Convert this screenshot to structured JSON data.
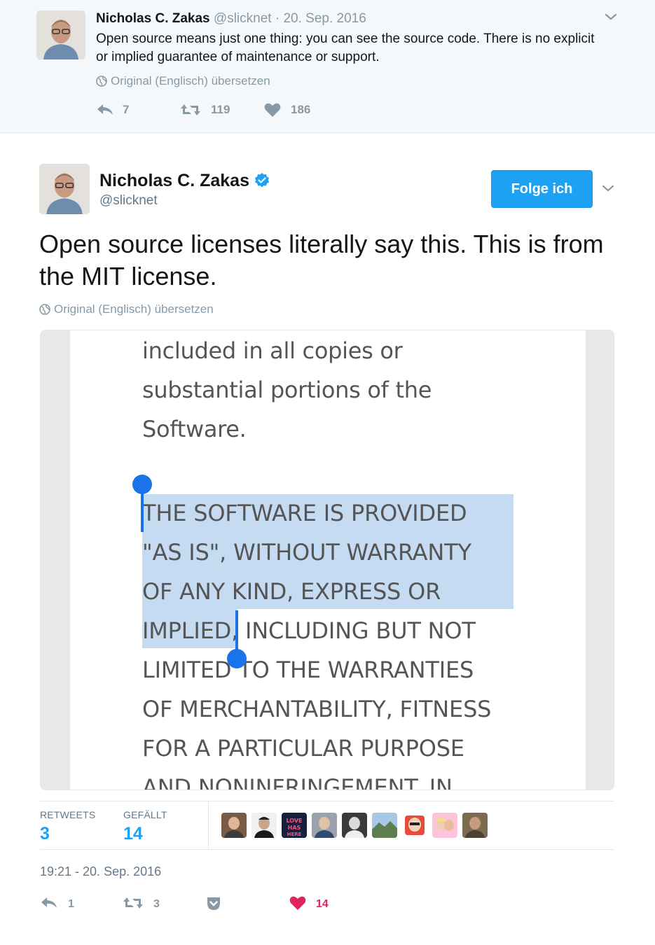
{
  "parent_tweet": {
    "author_name": "Nicholas C. Zakas",
    "handle": "@slicknet",
    "separator": "·",
    "date": "20. Sep. 2016",
    "text": "Open source means just one thing: you can see the source code. There is no explicit or implied guarantee of maintenance or support.",
    "translate_label": "Original (Englisch) übersetzen",
    "reply_count": "7",
    "retweet_count": "119",
    "like_count": "186"
  },
  "main_tweet": {
    "author_name": "Nicholas C. Zakas",
    "verified": true,
    "handle": "@slicknet",
    "follow_label": "Folge ich",
    "text": "Open source licenses literally say this. This is from the MIT license.",
    "translate_label": "Original (Englisch) übersetzen",
    "media_lines": [
      "included in all copies or",
      "substantial portions of the",
      "Software.",
      "THE SOFTWARE IS PROVIDED",
      "\"AS IS\", WITHOUT WARRANTY",
      "OF ANY KIND, EXPRESS OR",
      "IMPLIED, INCLUDING BUT NOT",
      "LIMITED TO THE WARRANTIES",
      "OF MERCHANTABILITY, FITNESS",
      "FOR A PARTICULAR PURPOSE",
      "AND NONINFRINGEMENT. IN"
    ],
    "stats": {
      "retweets_label": "RETWEETS",
      "retweets_value": "3",
      "likes_label": "GEFÄLLT",
      "likes_value": "14"
    },
    "timestamp": "19:21 - 20. Sep. 2016",
    "reply_count": "1",
    "retweet_count": "3",
    "like_count": "14"
  },
  "colors": {
    "accent": "#1da1f2",
    "like_active": "#e0245e",
    "muted": "#8899a6",
    "selection": "#94bee6",
    "handle_blue": "#1a73e8"
  }
}
